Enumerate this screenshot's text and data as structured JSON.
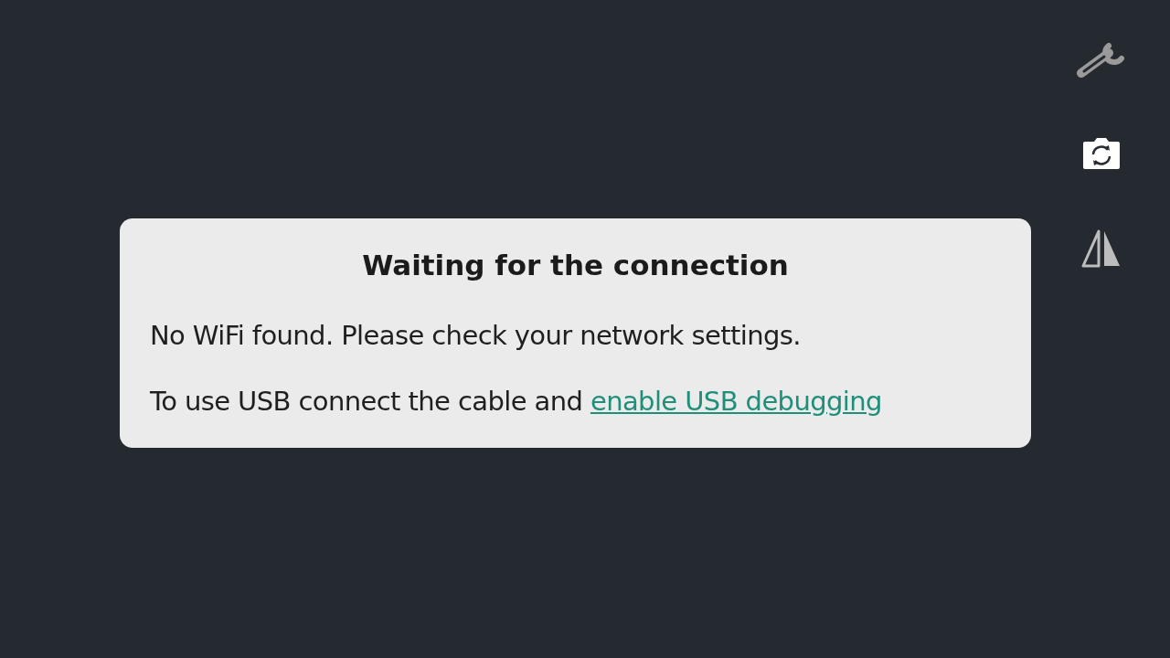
{
  "dialog": {
    "title": "Waiting for the connection",
    "message": "No WiFi found. Please check your network settings.",
    "usb_text": "To use USB connect the cable and",
    "usb_link": "enable USB debugging"
  }
}
